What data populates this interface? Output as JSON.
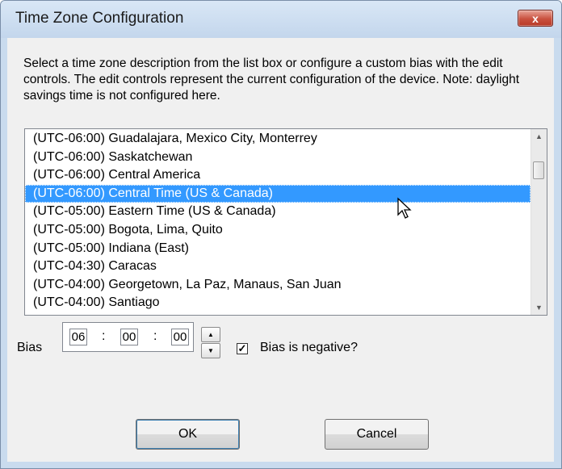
{
  "window": {
    "title": "Time Zone Configuration",
    "close_label": "x"
  },
  "description": "Select a time zone description from the list box or configure a custom bias with the edit controls.  The edit controls represent the current configuration of the device.  Note: daylight savings time is not configured here.",
  "list": {
    "items": [
      "(UTC-06:00) Guadalajara, Mexico City, Monterrey",
      "(UTC-06:00) Saskatchewan",
      "(UTC-06:00) Central America",
      "(UTC-06:00) Central Time (US & Canada)",
      "(UTC-05:00) Eastern Time (US & Canada)",
      "(UTC-05:00) Bogota, Lima, Quito",
      "(UTC-05:00) Indiana (East)",
      "(UTC-04:30) Caracas",
      "(UTC-04:00) Georgetown, La Paz, Manaus, San Juan",
      "(UTC-04:00) Santiago"
    ],
    "selected_index": 3,
    "selected_item": "(UTC-06:00) Central Time (US & Canada)"
  },
  "bias": {
    "label": "Bias",
    "hours": "06",
    "minutes": "00",
    "seconds": "00",
    "separator": ":",
    "negative_checked": true,
    "negative_label": "Bias is negative?",
    "check_glyph": "✓"
  },
  "buttons": {
    "ok": "OK",
    "cancel": "Cancel"
  },
  "colors": {
    "selection": "#3399ff",
    "window_frame": "#c9dbee",
    "close_button": "#c9513f"
  }
}
